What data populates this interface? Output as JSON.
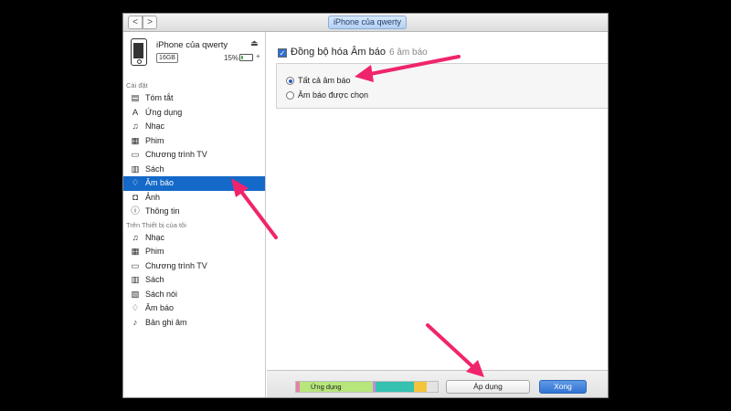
{
  "window": {
    "nav_back": "<",
    "nav_forward": ">",
    "title_tab": "iPhone của qwerty"
  },
  "device": {
    "name": "iPhone của qwerty",
    "capacity": "16GB",
    "battery": "15%",
    "battery_level_percent": 15,
    "eject_icon": "eject-icon",
    "charge_icon": "charging-icon"
  },
  "sidebar": {
    "settings_header": "Cài đặt",
    "settings_items": [
      {
        "label": "Tóm tắt",
        "icon": "summary-icon"
      },
      {
        "label": "Ứng dụng",
        "icon": "apps-icon"
      },
      {
        "label": "Nhạc",
        "icon": "music-icon"
      },
      {
        "label": "Phim",
        "icon": "movies-icon"
      },
      {
        "label": "Chương trình TV",
        "icon": "tv-icon"
      },
      {
        "label": "Sách",
        "icon": "books-icon"
      },
      {
        "label": "Âm báo",
        "icon": "bell-icon",
        "selected": true
      },
      {
        "label": "Ảnh",
        "icon": "camera-icon"
      },
      {
        "label": "Thông tin",
        "icon": "info-icon"
      }
    ],
    "device_header": "Trên Thiết bị của tôi",
    "device_items": [
      {
        "label": "Nhạc",
        "icon": "music-icon"
      },
      {
        "label": "Phim",
        "icon": "movies-icon"
      },
      {
        "label": "Chương trình TV",
        "icon": "tv-icon"
      },
      {
        "label": "Sách",
        "icon": "books-icon"
      },
      {
        "label": "Sách nói",
        "icon": "audiobook-icon"
      },
      {
        "label": "Âm báo",
        "icon": "bell-icon"
      },
      {
        "label": "Bản ghi âm",
        "icon": "voice-memo-icon"
      }
    ]
  },
  "main": {
    "sync_label": "Đồng bộ hóa Âm báo",
    "sync_count": "6 âm báo",
    "sync_checked": true,
    "options": [
      {
        "label": "Tất cả âm báo",
        "selected": true
      },
      {
        "label": "Âm báo được chọn",
        "selected": false
      }
    ]
  },
  "bottom": {
    "storage_apps_label": "Ứng dụng",
    "storage_colors": [
      "#e77fa8",
      "#b7e67a",
      "#c38be0",
      "#35c2b0",
      "#f4c43a",
      "#e3e3e3"
    ],
    "apply_label": "Áp dụng",
    "done_label": "Xong"
  },
  "colors": {
    "selection": "#1469c9",
    "annotation_arrow": "#f0246c",
    "done_button": "#3274d3"
  }
}
